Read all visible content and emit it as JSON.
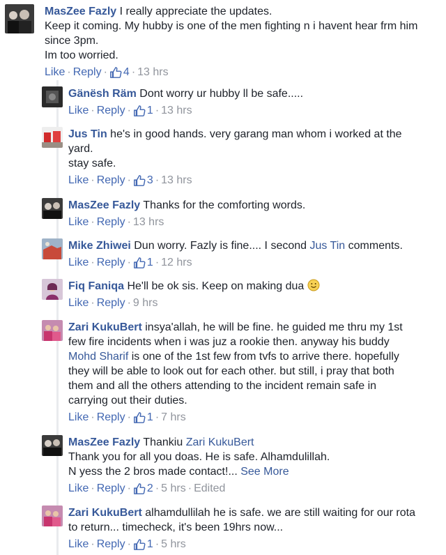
{
  "comments": [
    {
      "author": "MasZee Fazly",
      "lines": [
        "I really appreciate the updates.",
        "Keep it coming. My hubby is one of the men fighting n i havent hear frm him",
        "since 3pm.",
        "Im too worried."
      ],
      "like": "Like",
      "reply": "Reply",
      "likes": "4",
      "time": "13 hrs"
    }
  ],
  "replies": [
    {
      "author": "Gänësh Räm",
      "text": "Dont worry ur hubby ll be safe.....",
      "like": "Like",
      "reply": "Reply",
      "likes": "1",
      "time": "13 hrs"
    },
    {
      "author": "Jus Tin",
      "line1": "he's in good hands. very garang man whom i worked at the",
      "line2": "yard.",
      "line3": "stay safe.",
      "like": "Like",
      "reply": "Reply",
      "likes": "3",
      "time": "13 hrs"
    },
    {
      "author": "MasZee Fazly",
      "text": "Thanks for the comforting words.",
      "like": "Like",
      "reply": "Reply",
      "time": "13 hrs"
    },
    {
      "author": "Mike Zhiwei",
      "text_before": "Dun worry. Fazly is fine.... I second",
      "mention": "Jus Tin",
      "text_after": "comments.",
      "like": "Like",
      "reply": "Reply",
      "likes": "1",
      "time": "12 hrs"
    },
    {
      "author": "Fiq Faniqa",
      "text": "He'll be ok sis. Keep on making dua",
      "like": "Like",
      "reply": "Reply",
      "time": "9 hrs"
    },
    {
      "author": "Zari KukuBert",
      "line1": "insya'allah, he will be fine. he guided me thru my 1st",
      "line2": "few fire incidents when i was juz a rookie then. anyway his buddy",
      "mention": "Mohd Sharif",
      "line3": "is one of the 1st few from tvfs to arrive there. hopefully",
      "line4": "they will be able to look out for each other. but still, i pray that both",
      "line5": "them and all the others attending to the incident remain safe in",
      "line6": "carrying out their duties.",
      "like": "Like",
      "reply": "Reply",
      "likes": "1",
      "time": "7 hrs"
    },
    {
      "author": "MasZee Fazly",
      "line1": "Thankiu",
      "mention": "Zari KukuBert",
      "line2": "Thank you for all you doas. He is safe. Alhamdulillah.",
      "line3": "N yess the 2 bros made contact!...",
      "see_more": "See More",
      "like": "Like",
      "reply": "Reply",
      "likes": "2",
      "time": "5 hrs",
      "edited": "Edited"
    },
    {
      "author": "Zari KukuBert",
      "line1": "alhamdullilah he is safe. we are still waiting for our rota",
      "line2": "to return... timecheck, it's been 19hrs now...",
      "like": "Like",
      "reply": "Reply",
      "likes": "1",
      "time": "5 hrs"
    }
  ],
  "colors": {
    "link": "#365899",
    "action": "#4267b2",
    "meta": "#90949c",
    "text": "#1d2129"
  },
  "icons": {
    "like": "thumbs-up-icon",
    "emoji": "smiley-emoji-icon"
  }
}
